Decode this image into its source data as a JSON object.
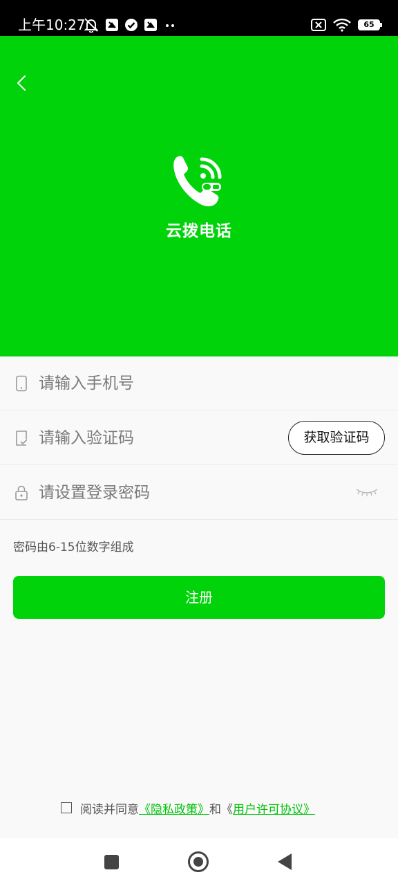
{
  "status_bar": {
    "time": "上午10:27",
    "battery": "65",
    "icons": [
      "mute-icon",
      "app-notification-icon",
      "check-circle-icon",
      "app-notification-icon",
      "more-dots-icon",
      "sim-off-icon",
      "wifi-icon",
      "battery-icon"
    ]
  },
  "header": {
    "app_name": "云拨电话",
    "background_color": "#00d30a"
  },
  "form": {
    "phone_placeholder": "请输入手机号",
    "code_placeholder": "请输入验证码",
    "get_code_label": "获取验证码",
    "password_placeholder": "请设置登录密码",
    "password_hint": "密码由6-15位数字组成",
    "register_label": "注册"
  },
  "agreement": {
    "prefix": "阅读并同意",
    "privacy_link": "《隐私政策》",
    "and_text": "和《",
    "license_link": "用户许可协议》"
  },
  "colors": {
    "accent": "#00d30a",
    "link": "#00c209"
  }
}
